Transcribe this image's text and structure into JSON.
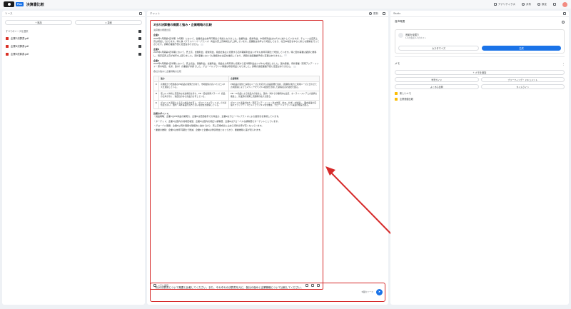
{
  "app": {
    "badge": "Plus",
    "title": "決算書比較"
  },
  "top": {
    "analytics": "アナリティクス",
    "share": "共有",
    "settings": "設定"
  },
  "sources": {
    "title": "ソース",
    "add": "追加",
    "discover": "探索",
    "select_all": "すべてのソースを選択",
    "items": [
      "企業C決算書.pdf",
      "企業D決算書.pdf",
      "企業E決算書.pdf"
    ]
  },
  "chat": {
    "title": "チャット",
    "refresh": "更新",
    "answer_title": "3社の決算書の概要と強み・企業戦略の比較",
    "answer_sub": "決算書の概要比較",
    "sections": [
      {
        "heading": "企業C",
        "text": "2025年3月期第3四半期（9月期）において、営業収益は前年同期比で増加となりました。営業利益、経常利益、中間純利益はわずかに減少していますが、チェーン全店売上高は増加しております。特に株（グラスペーパーブランド）商品の売上高構成比が上昇しています。店舗数は前年より増加しており、北日本地区を中心に新たな展開を行っております。通期の業績予想に変更はありません。"
      },
      {
        "heading": "企業D",
        "text": "2025年2月期第3四半期において、売上高、営業利益、経常利益、親会社株主に帰属する四半期純利益はいずれも前年同期比で増加しています。特に国内事業は堅調に推移し、既存店売上高が前年を上回りました。海外事業においても積極的な出店を継続しており、通期の連結業績予想に変更はありません。"
      },
      {
        "heading": "企業E",
        "text": "2025年8月期第1四半期において、売上収益、事業利益、営業利益、親会社の所有者に帰属する四半期利益はいずれも増加しました。国内事業、海外事業（東南アジア・インド・豪州地区、北米、欧州）の業績が好調でした。グローバルブランド事業は増収増益となりました。通期の連結業績予想に変更はありません。"
      }
    ],
    "table_heading": "各社の強みと企業戦略の比較",
    "table_header": [
      "",
      "強み",
      "企業戦略"
    ],
    "table_rows": [
      [
        "C",
        "高機能かつ低価格なPB商品の開発力があり、市場価値の高いマスビジネスを展開している。",
        "PB商品の強化と多様なニーズに対応する商品開発を進め、店舗網の拡大と地域ニーズに合わせた売場展開によってメディアやデジタル販促を活用した顧客接点の強化を図る。"
      ],
      [
        "D",
        "低コスト体質と安定的な収益構造を持ち、PB（自社開発ブランド）商品の比率が高く、独自性のある商品力を有している。",
        "PB・JV商品による製品力の強化と、国内・海外での積極的な出店、オンラインストアとの連携を推進し、新業態の開発と店舗網の拡大を図る。"
      ],
      [
        "E",
        "グローバル展開による高い成長力を有し、グローバルブランドとしての認知度が高い。国内・海外事業の双方で高い収益性を確保している。",
        "グローバル事業の拡大（東南アジア・インド・豪州地区、欧州、北米）を加速し、国内事業の店舗スクラップアンドビルドとデジタル化を推進、グローバルブランド事業の成長を図る。"
      ]
    ],
    "points_heading": "比較のポイント：",
    "points": [
      "・製品戦略：企業CはPB商品の開発力、企業Dは低価格帯での商品力、企業Eはグローバルブランドによる差別化を重視しています。",
      "・ターゲット：企業Cは国内の地域密着型、企業Dは国内の幅広い顧客層、企業Eはグローバルな顧客層をターゲットとしています。",
      "・グローバル展開：企業Eは海外展開を積極的に進めており、売上高構成比に占める海外比率が高くなっています。",
      "・業績の推移：企業Cは前年同期比で微減、企業Dと企業Eは増収増益となっており、業績推移に差が見られます。"
    ],
    "save_memo": "メモに保存",
    "input_text": "3社の決算書について概要と比較してください。また、それぞれの決算書を元に、各社の強みと企業戦略について比較してください。",
    "source_count": "3個のソース"
  },
  "studio": {
    "title": "Studio",
    "audio_label": "音声概要",
    "audio_card_title": "音楽を深掘り",
    "audio_card_sub": "1人の会話 2人のホスト",
    "customize": "カスタマイズ",
    "generate": "生成",
    "memo_label": "メモ",
    "add_memo": "メモを追加",
    "chips": [
      "学習ガイド",
      "ブリーフィング・ドキュメント",
      "よくある質問",
      "タイムライン"
    ],
    "notes": [
      "新しいメモ",
      "企業価値比較"
    ]
  }
}
